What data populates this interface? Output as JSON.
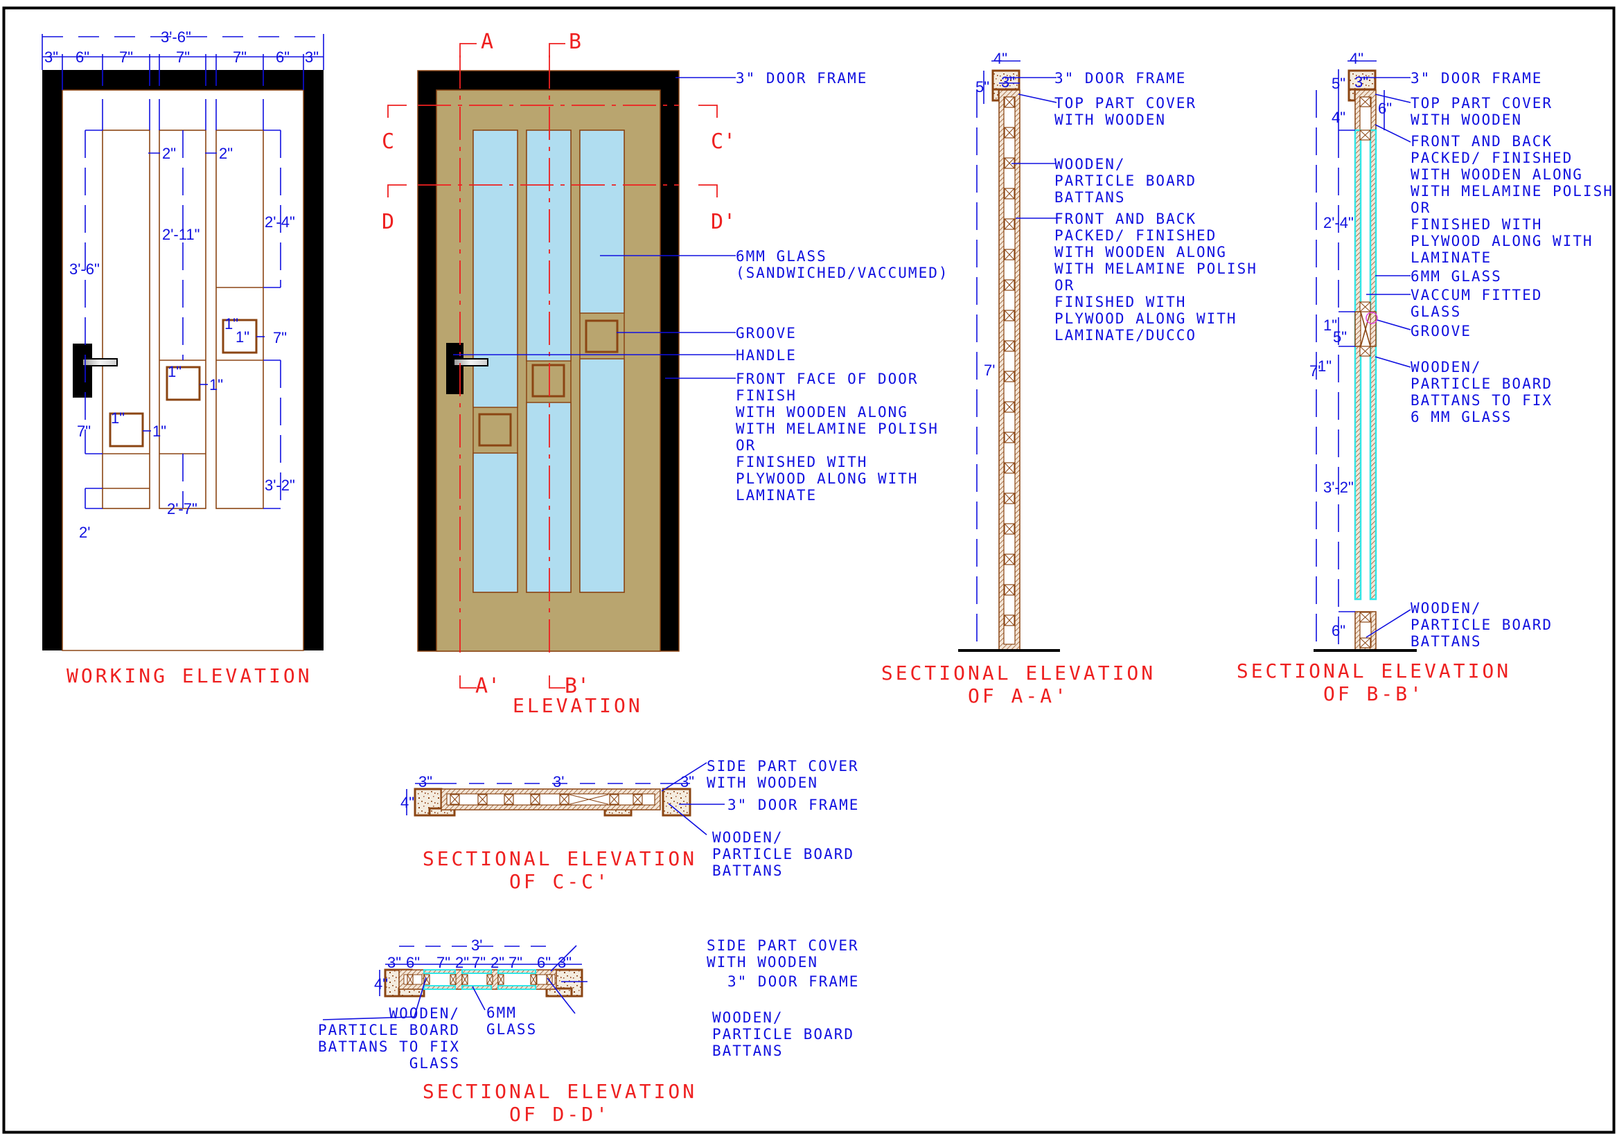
{
  "colors": {
    "frame": "#000000",
    "wood": "#b9a56f",
    "glass": "#b0ddf0",
    "section_glass": "#33e6e6",
    "outline": "#8b4513",
    "annotation": "#1010e0",
    "title": "#ee2020"
  },
  "working_elevation": {
    "title": "WORKING ELEVATION",
    "overall_width": "3'-6\"",
    "width_segments": [
      "3\"",
      "6\"",
      "7\"",
      "7\"",
      "7\"",
      "6\"",
      "3\""
    ],
    "gaps": [
      "2\"",
      "2\""
    ],
    "heights": {
      "left_top": "3'-6\"",
      "left_groove": "7\"",
      "left_bottom": "2'",
      "mid_top": "2'-11\"",
      "mid_bottom": "2'-7\"",
      "right_top": "2'-4\"",
      "right_groove": "7\"",
      "right_bottom": "3'-2\""
    },
    "groove_offsets": [
      "1\"",
      "1\""
    ]
  },
  "elevation": {
    "title": "ELEVATION",
    "cut_marks": [
      "A",
      "B",
      "C",
      "C'",
      "D",
      "D'",
      "A'",
      "B'"
    ],
    "callouts": [
      {
        "text": [
          "3\" DOOR FRAME"
        ]
      },
      {
        "text": [
          "6MM GLASS",
          "(SANDWICHED/VACCUMED)"
        ]
      },
      {
        "text": [
          "GROOVE"
        ]
      },
      {
        "text": [
          "HANDLE"
        ]
      },
      {
        "text": [
          "FRONT FACE OF DOOR",
          "FINISH",
          "WITH WOODEN ALONG",
          "WITH MELAMINE POLISH",
          "OR",
          "FINISHED WITH",
          "PLYWOOD ALONG WITH",
          "LAMINATE"
        ]
      }
    ]
  },
  "section_aa": {
    "title": [
      "SECTIONAL ELEVATION",
      "OF A-A'"
    ],
    "dims": {
      "frame_w": "4\"",
      "frame_h": "5\"",
      "frame_inner": "3\"",
      "height": "7'"
    },
    "callouts": [
      {
        "text": [
          "3\" DOOR FRAME"
        ]
      },
      {
        "text": [
          "TOP PART COVER",
          "WITH WOODEN"
        ]
      },
      {
        "text": [
          "WOODEN/",
          "PARTICLE BOARD",
          "BATTANS"
        ]
      },
      {
        "text": [
          "FRONT AND BACK",
          "PACKED/ FINISHED",
          "WITH WOODEN ALONG",
          "WITH MELAMINE POLISH",
          "OR",
          "FINISHED WITH",
          "PLYWOOD ALONG WITH",
          "LAMINATE/DUCCO"
        ]
      }
    ]
  },
  "section_bb": {
    "title": [
      "SECTIONAL ELEVATION",
      "OF B-B'"
    ],
    "dims": {
      "frame_w": "4\"",
      "frame_h": "5\"",
      "frame_inner": "3\"",
      "top_rail": "6\"",
      "top_offset": "4\"",
      "upper_glass": "2'-4\"",
      "groove_gap_top": "1\"",
      "groove": "5\"",
      "groove_gap_bottom": "1\"",
      "overall": "7'",
      "lower_glass": "3'-2\"",
      "bottom_rail": "6\""
    },
    "callouts": [
      {
        "text": [
          "3\" DOOR FRAME"
        ]
      },
      {
        "text": [
          "TOP PART COVER",
          "WITH WOODEN"
        ]
      },
      {
        "text": [
          "FRONT AND BACK",
          "PACKED/ FINISHED",
          "WITH WOODEN ALONG",
          "WITH MELAMINE POLISH",
          "OR",
          "FINISHED WITH",
          "PLYWOOD ALONG WITH",
          "LAMINATE"
        ]
      },
      {
        "text": [
          "6MM GLASS"
        ]
      },
      {
        "text": [
          "VACCUM FITTED",
          "GLASS"
        ]
      },
      {
        "text": [
          "GROOVE"
        ]
      },
      {
        "text": [
          "WOODEN/",
          "PARTICLE BOARD",
          "BATTANS TO FIX",
          "6 MM GLASS"
        ]
      },
      {
        "text": [
          "WOODEN/",
          "PARTICLE BOARD",
          "BATTANS"
        ]
      }
    ]
  },
  "section_cc": {
    "title": [
      "SECTIONAL ELEVATION",
      "OF C-C'"
    ],
    "dims": {
      "left": "3\"",
      "middle": "3'",
      "right": "3\"",
      "depth": "4\""
    },
    "callouts": [
      {
        "text": [
          "SIDE PART COVER",
          "WITH WOODEN"
        ]
      },
      {
        "text": [
          "3\" DOOR FRAME"
        ]
      },
      {
        "text": [
          "WOODEN/",
          "PARTICLE BOARD",
          "BATTANS"
        ]
      }
    ]
  },
  "section_dd": {
    "title": [
      "SECTIONAL ELEVATION",
      "OF D-D'"
    ],
    "dims": {
      "overall": "3'",
      "segments": [
        "3\"",
        "6\"",
        "7\"",
        "2\"",
        "7\"",
        "2\"",
        "7\"",
        "6\"",
        "3\""
      ],
      "depth": "4\""
    },
    "callouts": [
      {
        "text": [
          "SIDE PART COVER",
          "WITH WOODEN"
        ]
      },
      {
        "text": [
          "3\" DOOR FRAME"
        ]
      },
      {
        "text": [
          "WOODEN/",
          "PARTICLE BOARD",
          "BATTANS"
        ]
      },
      {
        "text": [
          "6MM",
          "GLASS"
        ]
      },
      {
        "text": [
          "WOODEN/",
          "PARTICLE BOARD",
          "BATTANS TO FIX",
          "GLASS"
        ]
      }
    ]
  }
}
